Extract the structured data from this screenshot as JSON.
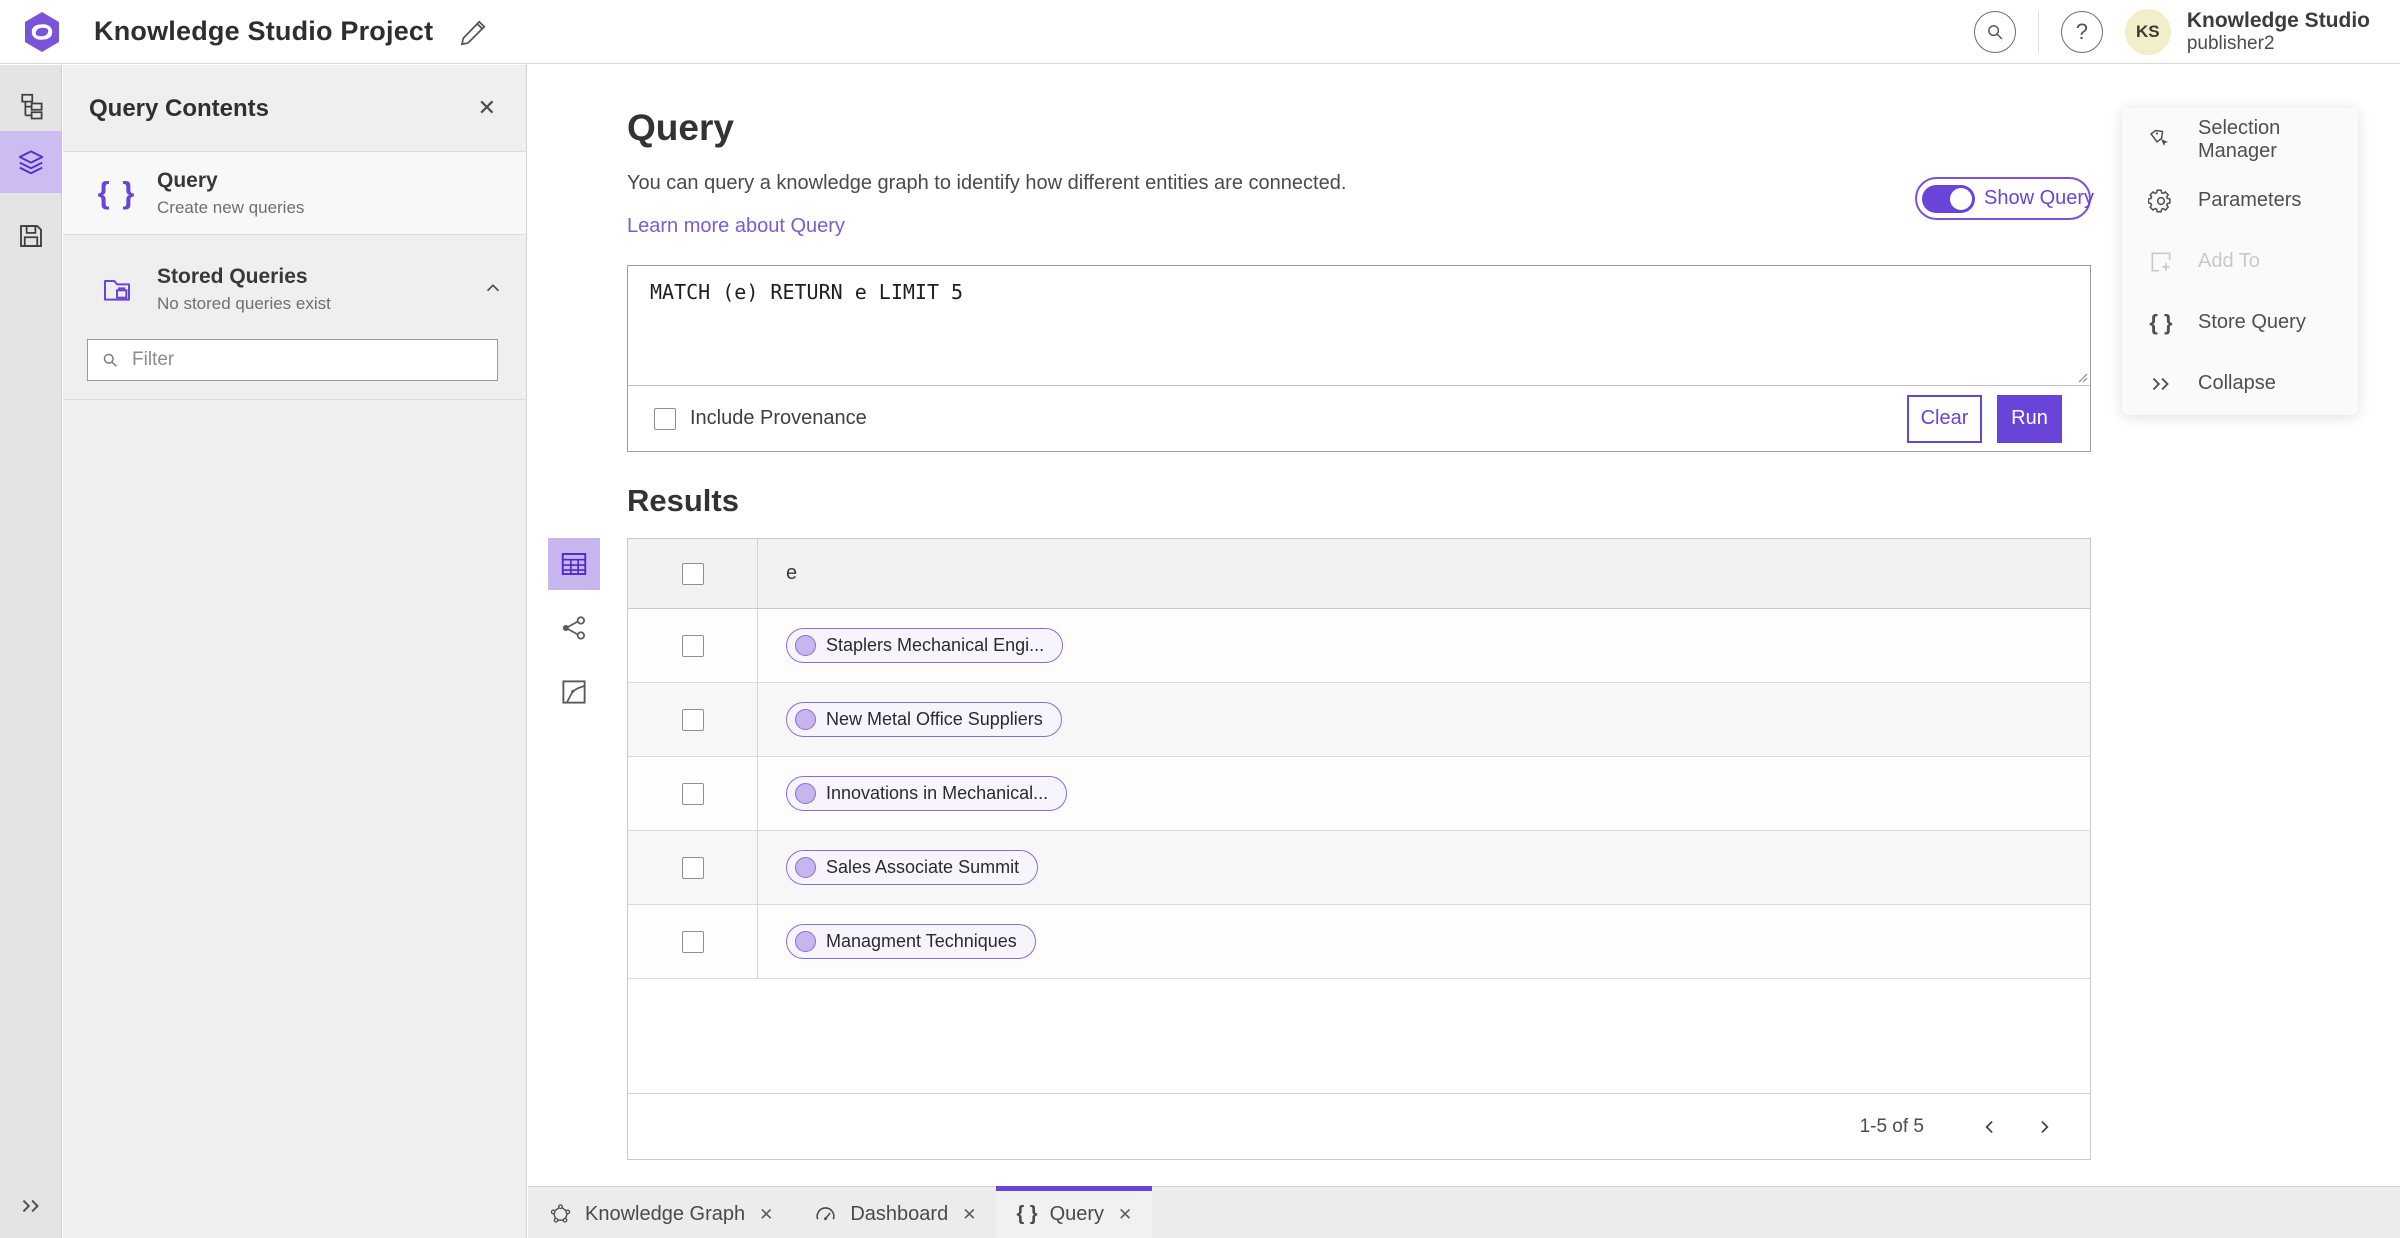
{
  "header": {
    "title": "Knowledge Studio Project",
    "app_name": "Knowledge Studio",
    "user_name": "publisher2",
    "avatar_initials": "KS"
  },
  "sidebar": {
    "icons": [
      "knowledge-graph",
      "layers",
      "save",
      "expand"
    ]
  },
  "query_contents": {
    "title": "Query Contents",
    "close_icon": "close-x",
    "items": [
      {
        "label": "Query",
        "description": "Create new queries",
        "icon": "curly-braces",
        "icon_glyph": "{ }"
      },
      {
        "label": "Stored Queries",
        "description": "No stored queries exist",
        "icon": "stored-folder"
      }
    ],
    "filter_placeholder": "Filter"
  },
  "query_panel": {
    "title": "Query",
    "description": "You can query a knowledge graph to identify how different entities are connected.",
    "learn_more": "Learn more about Query",
    "show_query_label": "Show Query",
    "show_query_on": true,
    "query_text": "MATCH (e) RETURN e LIMIT 5",
    "include_provenance_label": "Include Provenance",
    "include_provenance_checked": false,
    "clear_label": "Clear",
    "run_label": "Run"
  },
  "results": {
    "title": "Results",
    "view_icons": [
      "table-view",
      "link-chart-view",
      "map-view"
    ],
    "active_view": "table-view",
    "column_header": "e",
    "rows": [
      {
        "label": "Staplers Mechanical Engi..."
      },
      {
        "label": "New Metal Office Suppliers"
      },
      {
        "label": "Innovations in Mechanical..."
      },
      {
        "label": "Sales Associate Summit"
      },
      {
        "label": "Managment Techniques"
      }
    ],
    "pagination": {
      "range": "1-5 of 5"
    }
  },
  "action_panel": {
    "items": [
      {
        "label": "Selection Manager",
        "icon": "selection-tag-cursor",
        "disabled": false
      },
      {
        "label": "Parameters",
        "icon": "gear",
        "disabled": false
      },
      {
        "label": "Add To",
        "icon": "add-to-square",
        "disabled": true
      },
      {
        "label": "Store Query",
        "icon": "curly-braces",
        "icon_glyph": "{ }",
        "disabled": false
      },
      {
        "label": "Collapse",
        "icon": "double-chevron-right",
        "disabled": false
      }
    ]
  },
  "tabs": [
    {
      "label": "Knowledge Graph",
      "icon": "network-graph",
      "active": false
    },
    {
      "label": "Dashboard",
      "icon": "gauge",
      "active": false
    },
    {
      "label": "Query",
      "icon": "curly-braces",
      "icon_glyph": "{ }",
      "active": true
    }
  ],
  "colors": {
    "accent": "#6a44d8",
    "accent_light": "#cdbcf2",
    "link": "#7a5cd6",
    "pill_border": "#8a6ce0",
    "pill_bg": "#f7f4fd",
    "avatar_bg": "#f1eec9",
    "panel_bg": "#efefef",
    "rail_bg": "#e4e4e4"
  }
}
